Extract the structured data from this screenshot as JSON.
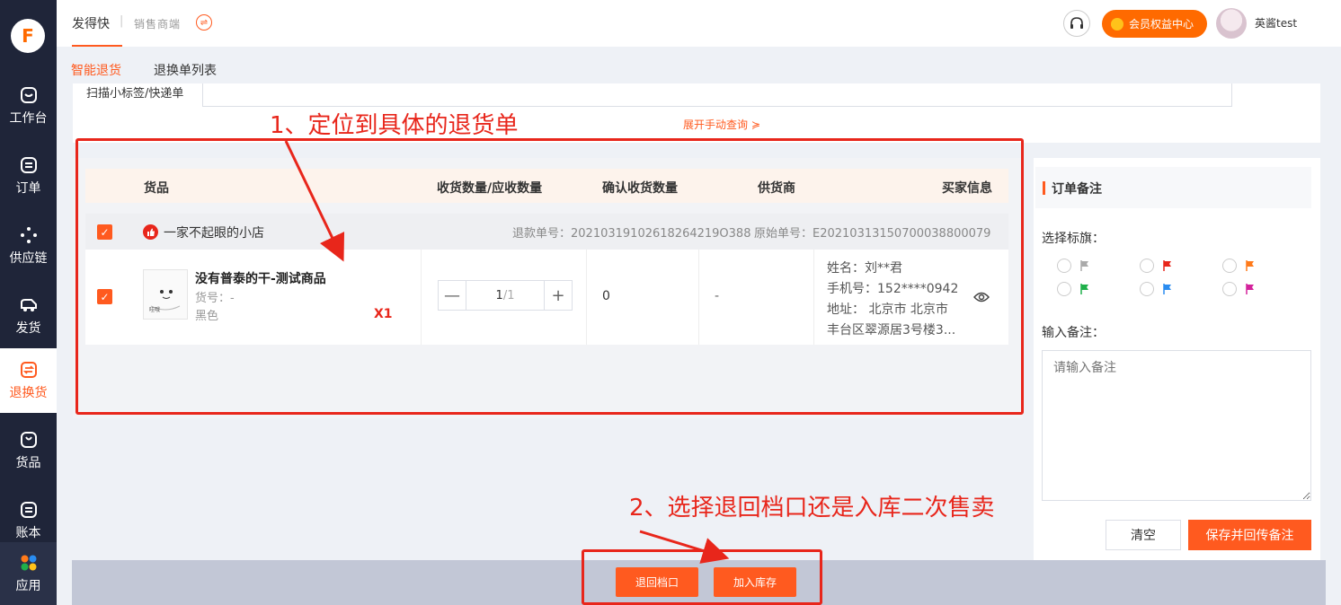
{
  "sidebar": {
    "logo": "F",
    "items": [
      {
        "label": "工作台",
        "icon": "workbench-icon"
      },
      {
        "label": "订单",
        "icon": "order-icon"
      },
      {
        "label": "供应链",
        "icon": "supply-chain-icon"
      },
      {
        "label": "发货",
        "icon": "delivery-truck-icon"
      },
      {
        "label": "退换货",
        "icon": "return-exchange-icon"
      },
      {
        "label": "货品",
        "icon": "goods-bag-icon"
      },
      {
        "label": "账本",
        "icon": "ledger-icon"
      },
      {
        "label": "应用",
        "icon": "apps-grid-icon"
      }
    ]
  },
  "header": {
    "brand": "发得快",
    "separator": "|",
    "sub": "销售商端",
    "vip_label": "会员权益中心",
    "username": "英酱test"
  },
  "tabs": [
    {
      "label": "智能退货",
      "active": true
    },
    {
      "label": "退换单列表",
      "active": false
    }
  ],
  "search": {
    "label": "扫描小标签/快递单",
    "expand_link": "展开手动查询 ≽"
  },
  "table": {
    "headers": [
      "货品",
      "收货数量/应收数量",
      "确认收货数量",
      "供货商",
      "买家信息"
    ],
    "shop_name": "一家不起眼的小店",
    "refund_no": "退款单号：20210319102618264219O388",
    "origin_no": "原始单号：E20210313150700038800079",
    "row": {
      "product_name": "没有普泰的干-测试商品",
      "sku_no": "货号：-",
      "color": "黑色",
      "multiplier": "X1",
      "qty_value": "1",
      "qty_total": "/1",
      "minus": "—",
      "plus": "+",
      "confirmed_qty": "0",
      "supplier": "-",
      "buyer_name": "姓名：刘**君",
      "buyer_phone": "手机号：152****0942",
      "buyer_addr1": "地址： 北京市 北京市",
      "buyer_addr2": "丰台区翠源居3号楼3..."
    }
  },
  "note_panel": {
    "title": "订单备注",
    "flag_label": "选择标旗：",
    "flags": [
      "#aaaaaa",
      "#e8261b",
      "#ff7a1a",
      "#1fb04a",
      "#2a8cf0",
      "#d4239c"
    ],
    "input_label": "输入备注：",
    "placeholder": "请输入备注",
    "clear_btn": "清空",
    "save_btn": "保存并回传备注"
  },
  "footer": {
    "return_btn": "退回档口",
    "stock_btn": "加入库存"
  },
  "annotations": {
    "step1": "1、定位到具体的退货单",
    "step2": "2、选择退回档口还是入库二次售卖",
    "color": "#e8261b"
  }
}
